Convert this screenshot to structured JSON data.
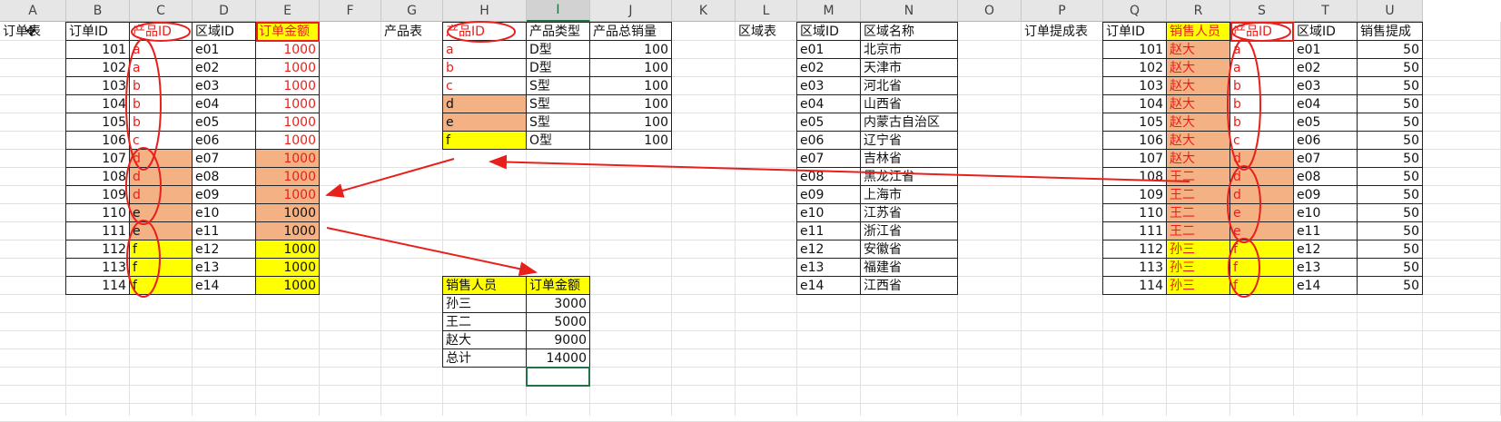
{
  "columns": [
    "A",
    "B",
    "C",
    "D",
    "E",
    "F",
    "G",
    "H",
    "I",
    "J",
    "K",
    "L",
    "M",
    "N",
    "O",
    "P",
    "Q",
    "R",
    "S",
    "T",
    "U"
  ],
  "selected_column": "I",
  "colors": {
    "orange_fill": "#f4b183",
    "yellow_fill": "#ffff00",
    "annotation_red": "#e8201c",
    "selection_green": "#217346"
  },
  "order_table": {
    "title": "订单表",
    "headers": [
      "订单ID",
      "产品ID",
      "区域ID",
      "订单金额"
    ],
    "rows": [
      {
        "id": "101",
        "product": "a",
        "region": "e01",
        "amount": "1000"
      },
      {
        "id": "102",
        "product": "a",
        "region": "e02",
        "amount": "1000"
      },
      {
        "id": "103",
        "product": "b",
        "region": "e03",
        "amount": "1000"
      },
      {
        "id": "104",
        "product": "b",
        "region": "e04",
        "amount": "1000"
      },
      {
        "id": "105",
        "product": "b",
        "region": "e05",
        "amount": "1000"
      },
      {
        "id": "106",
        "product": "c",
        "region": "e06",
        "amount": "1000"
      },
      {
        "id": "107",
        "product": "d",
        "region": "e07",
        "amount": "1000"
      },
      {
        "id": "108",
        "product": "d",
        "region": "e08",
        "amount": "1000"
      },
      {
        "id": "109",
        "product": "d",
        "region": "e09",
        "amount": "1000"
      },
      {
        "id": "110",
        "product": "e",
        "region": "e10",
        "amount": "1000"
      },
      {
        "id": "111",
        "product": "e",
        "region": "e11",
        "amount": "1000"
      },
      {
        "id": "112",
        "product": "f",
        "region": "e12",
        "amount": "1000"
      },
      {
        "id": "113",
        "product": "f",
        "region": "e13",
        "amount": "1000"
      },
      {
        "id": "114",
        "product": "f",
        "region": "e14",
        "amount": "1000"
      }
    ]
  },
  "product_table": {
    "title": "产品表",
    "headers": [
      "产品ID",
      "产品类型",
      "产品总销量"
    ],
    "rows": [
      {
        "id": "a",
        "type": "D型",
        "sales": "100"
      },
      {
        "id": "b",
        "type": "D型",
        "sales": "100"
      },
      {
        "id": "c",
        "type": "S型",
        "sales": "100"
      },
      {
        "id": "d",
        "type": "S型",
        "sales": "100"
      },
      {
        "id": "e",
        "type": "S型",
        "sales": "100"
      },
      {
        "id": "f",
        "type": "O型",
        "sales": "100"
      }
    ]
  },
  "summary_table": {
    "headers": [
      "销售人员",
      "订单金额"
    ],
    "rows": [
      {
        "name": "孙三",
        "amount": "3000"
      },
      {
        "name": "王二",
        "amount": "5000"
      },
      {
        "name": "赵大",
        "amount": "9000"
      },
      {
        "name": "总计",
        "amount": "14000"
      }
    ]
  },
  "region_table": {
    "title": "区域表",
    "headers": [
      "区域ID",
      "区域名称"
    ],
    "rows": [
      {
        "id": "e01",
        "name": "北京市"
      },
      {
        "id": "e02",
        "name": "天津市"
      },
      {
        "id": "e03",
        "name": "河北省"
      },
      {
        "id": "e04",
        "name": "山西省"
      },
      {
        "id": "e05",
        "name": "内蒙古自治区"
      },
      {
        "id": "e06",
        "name": "辽宁省"
      },
      {
        "id": "e07",
        "name": "吉林省"
      },
      {
        "id": "e08",
        "name": "黑龙江省"
      },
      {
        "id": "e09",
        "name": "上海市"
      },
      {
        "id": "e10",
        "name": "江苏省"
      },
      {
        "id": "e11",
        "name": "浙江省"
      },
      {
        "id": "e12",
        "name": "安徽省"
      },
      {
        "id": "e13",
        "name": "福建省"
      },
      {
        "id": "e14",
        "name": "江西省"
      }
    ]
  },
  "commission_table": {
    "title": "订单提成表",
    "headers": [
      "订单ID",
      "销售人员",
      "产品ID",
      "区域ID",
      "销售提成"
    ],
    "rows": [
      {
        "id": "101",
        "seller": "赵大",
        "product": "a",
        "region": "e01",
        "commission": "50"
      },
      {
        "id": "102",
        "seller": "赵大",
        "product": "a",
        "region": "e02",
        "commission": "50"
      },
      {
        "id": "103",
        "seller": "赵大",
        "product": "b",
        "region": "e03",
        "commission": "50"
      },
      {
        "id": "104",
        "seller": "赵大",
        "product": "b",
        "region": "e04",
        "commission": "50"
      },
      {
        "id": "105",
        "seller": "赵大",
        "product": "b",
        "region": "e05",
        "commission": "50"
      },
      {
        "id": "106",
        "seller": "赵大",
        "product": "c",
        "region": "e06",
        "commission": "50"
      },
      {
        "id": "107",
        "seller": "赵大",
        "product": "d",
        "region": "e07",
        "commission": "50"
      },
      {
        "id": "108",
        "seller": "王二",
        "product": "d",
        "region": "e08",
        "commission": "50"
      },
      {
        "id": "109",
        "seller": "王二",
        "product": "d",
        "region": "e09",
        "commission": "50"
      },
      {
        "id": "110",
        "seller": "王二",
        "product": "e",
        "region": "e10",
        "commission": "50"
      },
      {
        "id": "111",
        "seller": "王二",
        "product": "e",
        "region": "e11",
        "commission": "50"
      },
      {
        "id": "112",
        "seller": "孙三",
        "product": "f",
        "region": "e12",
        "commission": "50"
      },
      {
        "id": "113",
        "seller": "孙三",
        "product": "f",
        "region": "e13",
        "commission": "50"
      },
      {
        "id": "114",
        "seller": "孙三",
        "product": "f",
        "region": "e14",
        "commission": "50"
      }
    ]
  }
}
